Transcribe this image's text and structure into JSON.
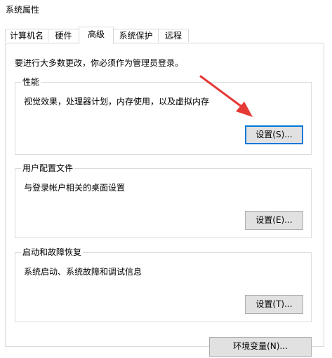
{
  "window": {
    "title": "系统属性"
  },
  "tabs": [
    {
      "label": "计算机名",
      "active": false
    },
    {
      "label": "硬件",
      "active": false
    },
    {
      "label": "高级",
      "active": true
    },
    {
      "label": "系统保护",
      "active": false
    },
    {
      "label": "远程",
      "active": false
    }
  ],
  "advanced": {
    "notice": "要进行大多数更改，你必须作为管理员登录。",
    "performance": {
      "title": "性能",
      "description": "视觉效果，处理器计划，内存使用，以及虚拟内存",
      "button_label": "设置(S)..."
    },
    "user_profiles": {
      "title": "用户配置文件",
      "description": "与登录帐户相关的桌面设置",
      "button_label": "设置(E)..."
    },
    "startup_recovery": {
      "title": "启动和故障恢复",
      "description": "系统启动、系统故障和调试信息",
      "button_label": "设置(T)..."
    },
    "env_vars_button_label": "环境变量(N)..."
  },
  "annotation": {
    "arrow_color": "#e53935",
    "arrow_icon": "red-arrow-pointer"
  },
  "colors": {
    "focus_border": "#0078d7",
    "button_face": "#e1e1e1"
  }
}
